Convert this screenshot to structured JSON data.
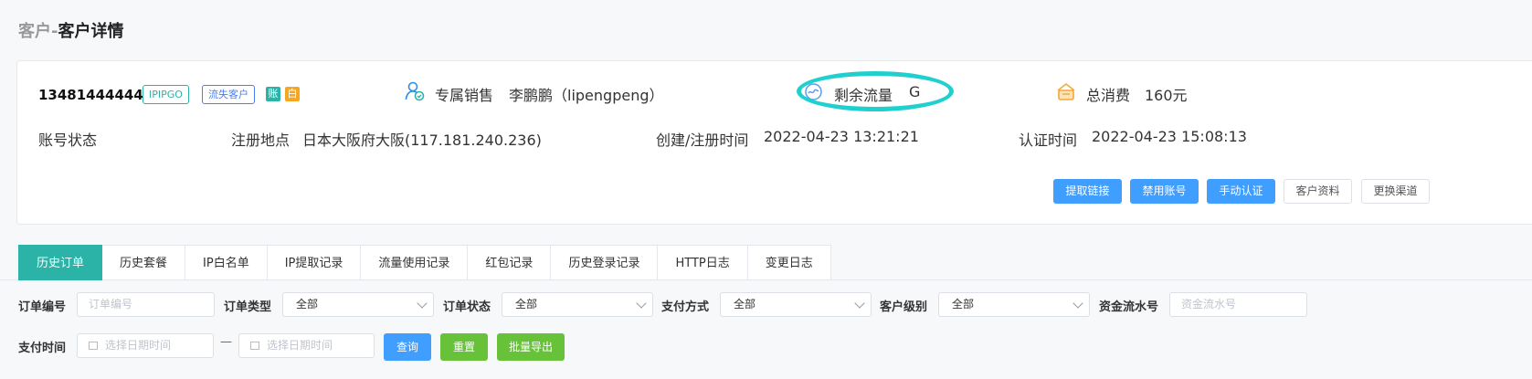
{
  "page": {
    "breadcrumb": "客户-",
    "title": "客户详情"
  },
  "customer": {
    "phone": "13481444444",
    "tags": [
      "IPIPGO",
      "流失客户"
    ],
    "mini_badges": [
      "账",
      "白"
    ],
    "sales_label": "专属销售",
    "sales_value": "李鹏鹏（lipengpeng）",
    "traffic_label": "剩余流量",
    "traffic_value": "G",
    "spend_label": "总消费",
    "spend_value": "160元",
    "account_status_label": "账号状态",
    "reg_place_label": "注册地点",
    "reg_place_value": "日本大阪府大阪(117.181.240.236)",
    "created_label": "创建/注册时间",
    "created_value": "2022-04-23 13:21:21",
    "verify_label": "认证时间",
    "verify_value": "2022-04-23 15:08:13"
  },
  "actions": {
    "extract_link": "提取链接",
    "disable_account": "禁用账号",
    "manual_verify": "手动认证",
    "customer_info": "客户资料",
    "change_channel": "更换渠道"
  },
  "tabs": [
    "历史订单",
    "历史套餐",
    "IP白名单",
    "IP提取记录",
    "流量使用记录",
    "红包记录",
    "历史登录记录",
    "HTTP日志",
    "变更日志"
  ],
  "filters": {
    "order_no_label": "订单编号",
    "order_no_placeholder": "订单编号",
    "order_type_label": "订单类型",
    "order_type_value": "全部",
    "order_status_label": "订单状态",
    "order_status_value": "全部",
    "pay_method_label": "支付方式",
    "pay_method_value": "全部",
    "customer_level_label": "客户级别",
    "customer_level_value": "全部",
    "fund_no_label": "资金流水号",
    "fund_no_placeholder": "资金流水号",
    "pay_time_label": "支付时间",
    "date_start_placeholder": "选择日期时间",
    "date_separator": "—",
    "date_end_placeholder": "选择日期时间",
    "query": "查询",
    "reset": "重置",
    "export": "批量导出"
  },
  "colors": {
    "teal": "#2bb3a8",
    "blue": "#409eff",
    "green": "#67c23a",
    "highlight": "#1fd0cf"
  }
}
